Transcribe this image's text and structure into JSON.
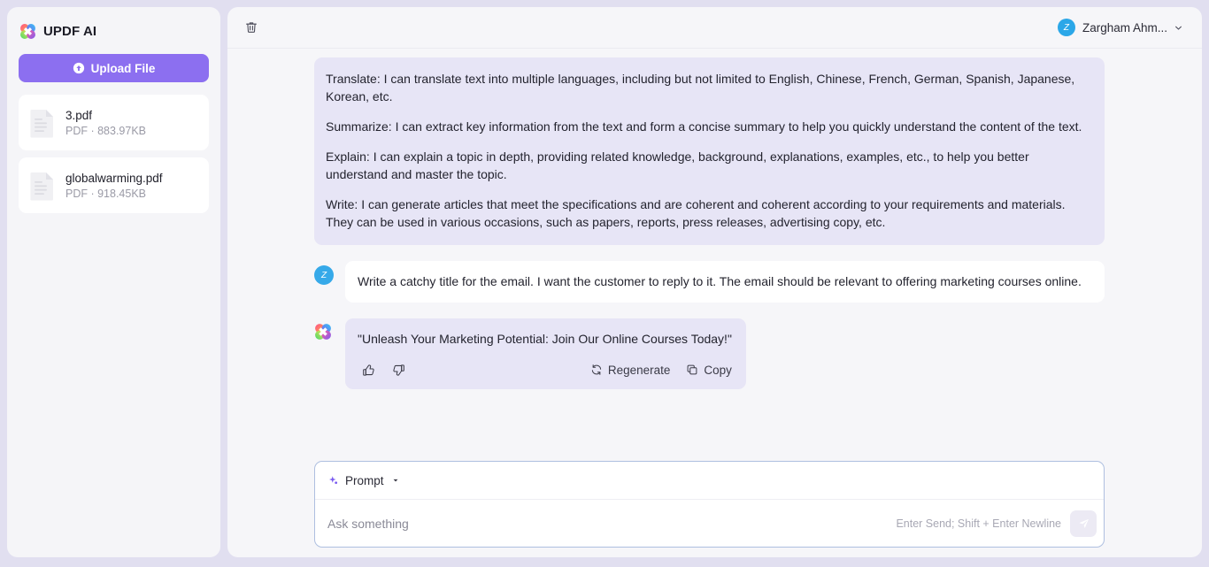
{
  "sidebar": {
    "brand_title": "UPDF AI",
    "logo_icon": "updf-clover-logo",
    "upload_button": {
      "label": "Upload File",
      "icon": "upload-arrow-circle-icon",
      "color": "#8c6ff0"
    },
    "files": [
      {
        "name": "3.pdf",
        "meta": "PDF · 883.97KB",
        "icon": "pdf-document-icon"
      },
      {
        "name": "globalwarming.pdf",
        "meta": "PDF · 918.45KB",
        "icon": "pdf-document-icon"
      }
    ]
  },
  "header": {
    "delete_icon": "trash-icon",
    "user": {
      "name": "Zargham Ahm...",
      "avatar_initial": "Z",
      "avatar_color": "#2ba7e8",
      "caret_icon": "chevron-down-icon"
    }
  },
  "chat": {
    "messages": [
      {
        "role": "assistant",
        "paragraphs": [
          "Translate: I can translate text into multiple languages, including but not limited to English, Chinese, French, German, Spanish, Japanese, Korean, etc.",
          "Summarize: I can extract key information from the text and form a concise summary to help you quickly understand the content of the text.",
          "Explain: I can explain a topic in depth, providing related knowledge, background, explanations, examples, etc., to help you better understand and master the topic.",
          "Write: I can generate articles that meet the specifications and are coherent and coherent according to your requirements and materials. They can be used in various occasions, such as papers, reports, press releases, advertising copy, etc."
        ]
      },
      {
        "role": "user",
        "avatar_initial": "Z",
        "text": "Write a catchy title for the email. I want the customer to reply to it. The email should be relevant to offering marketing courses online."
      },
      {
        "role": "assistant",
        "text": "\"Unleash Your Marketing Potential: Join Our Online Courses Today!\"",
        "actions": {
          "like_icon": "thumbs-up-icon",
          "dislike_icon": "thumbs-down-icon",
          "regenerate_label": "Regenerate",
          "regenerate_icon": "refresh-icon",
          "copy_label": "Copy",
          "copy_icon": "copy-icon"
        }
      }
    ]
  },
  "composer": {
    "prompt_label": "Prompt",
    "prompt_icon": "sparkle-icon",
    "prompt_caret_icon": "chevron-down-icon",
    "input_value": "",
    "input_placeholder": "Ask something",
    "send_hint": "Enter Send; Shift + Enter Newline",
    "send_icon": "send-plane-icon"
  },
  "colors": {
    "page_background": "#e1dff0",
    "panel_background": "#f6f6f9",
    "accent_purple": "#8c6ff0",
    "ai_bubble": "#e7e5f6"
  }
}
